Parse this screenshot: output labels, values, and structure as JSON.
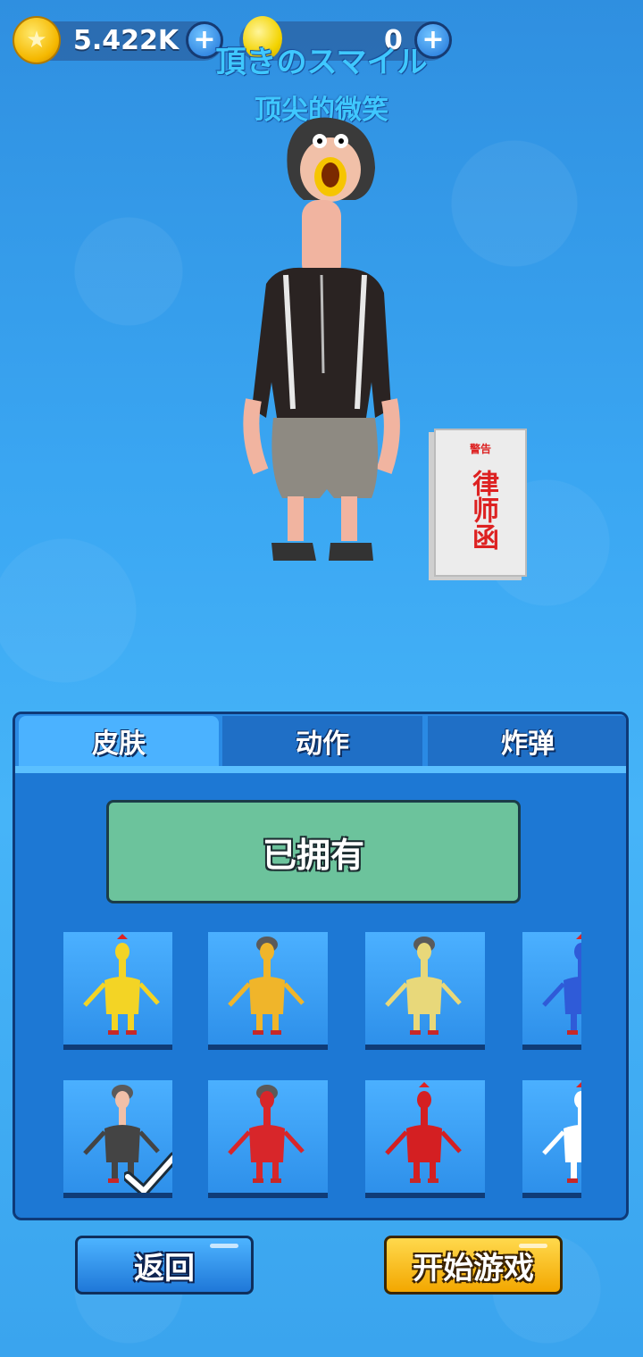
{
  "hud": {
    "coins": "5.422K",
    "gems": "0",
    "coin_icon": "star-coin-icon",
    "gem_icon": "gold-coin-icon",
    "plus": "+"
  },
  "character": {
    "name_jp": "頂きのスマイル",
    "name_cn": "顶尖的微笑",
    "prop_book": {
      "line1": "警告",
      "line2": "律师函"
    }
  },
  "tabs": [
    {
      "label": "皮肤",
      "active": true
    },
    {
      "label": "动作",
      "active": false
    },
    {
      "label": "炸弹",
      "active": false
    }
  ],
  "status_button": "已拥有",
  "skins": [
    {
      "color": "#f3d425",
      "hair": false,
      "selected": false
    },
    {
      "color": "#f0b52a",
      "hair": true,
      "selected": false
    },
    {
      "color": "#e8d87a",
      "hair": true,
      "selected": false
    },
    {
      "color": "#2f5bd8",
      "hair": false,
      "selected": false
    },
    {
      "color": "#444444",
      "hair": true,
      "selected": true
    },
    {
      "color": "#d8262a",
      "hair": true,
      "selected": false
    },
    {
      "color": "#d41f22",
      "hair": false,
      "selected": false
    },
    {
      "color": "#ffffff",
      "hair": false,
      "selected": false
    }
  ],
  "buttons": {
    "back": "返回",
    "start": "开始游戏"
  },
  "colors": {
    "accent": "#1d78d4",
    "start": "#f3b000",
    "owned": "#6cc39c"
  }
}
